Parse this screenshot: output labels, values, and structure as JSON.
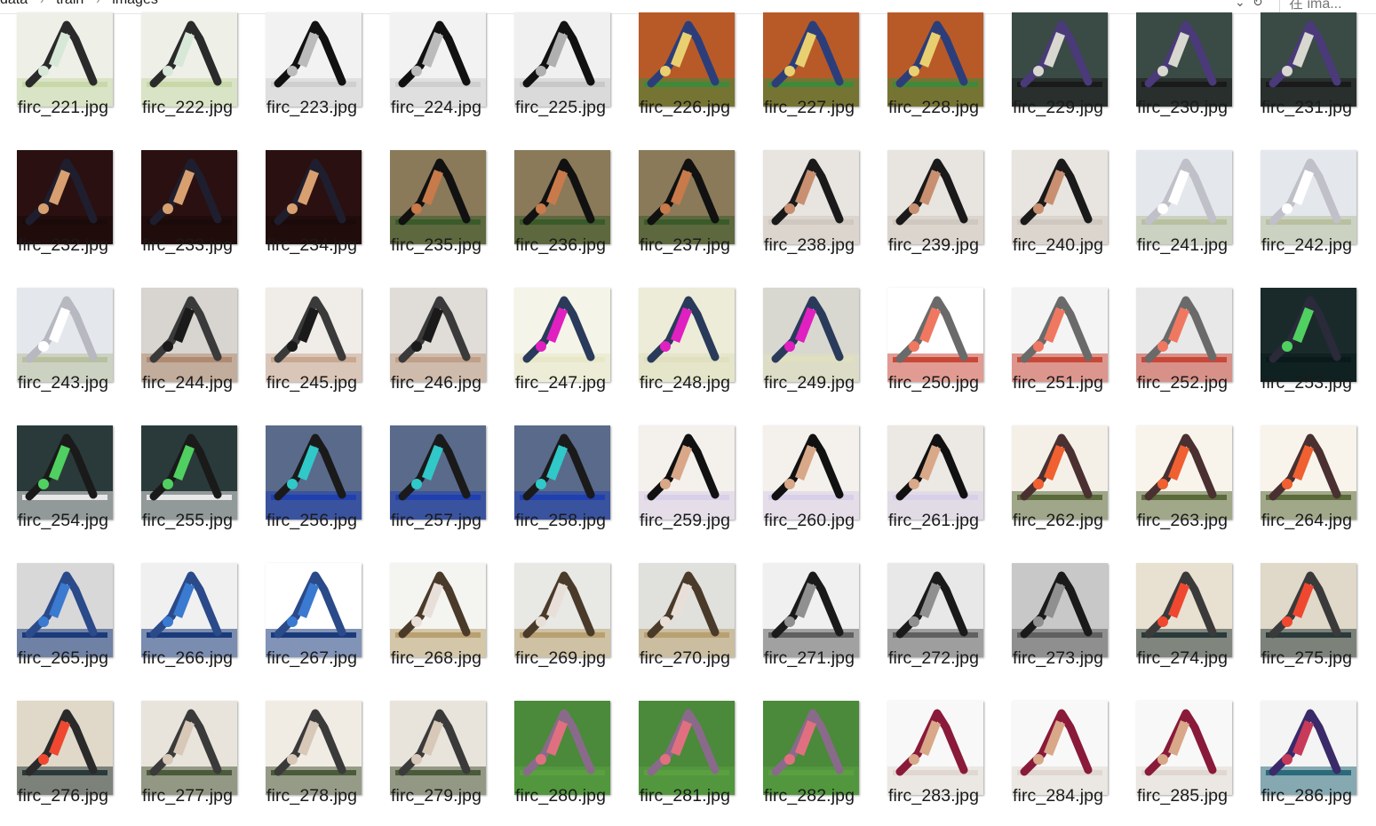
{
  "explorer": {
    "breadcrumb": [
      "data",
      "train",
      "images"
    ],
    "search_placeholder": "在 ima...",
    "accent": "#0078d7"
  },
  "files": [
    {
      "name": "firc_221.jpg",
      "palette": [
        "#eef0e8",
        "#c8d8a8",
        "#2a2a2a",
        "#d8e8d8"
      ]
    },
    {
      "name": "firc_222.jpg",
      "palette": [
        "#eef0e8",
        "#c8d8a8",
        "#2a2a2a",
        "#d8e8d8"
      ]
    },
    {
      "name": "firc_223.jpg",
      "palette": [
        "#f2f2f2",
        "#cfcfcf",
        "#111111",
        "#bbbbbb"
      ]
    },
    {
      "name": "firc_224.jpg",
      "palette": [
        "#f2f2f2",
        "#cfcfcf",
        "#111111",
        "#bbbbbb"
      ]
    },
    {
      "name": "firc_225.jpg",
      "palette": [
        "#f0f0f0",
        "#c8c8c8",
        "#111111",
        "#b0b0b0"
      ]
    },
    {
      "name": "firc_226.jpg",
      "palette": [
        "#b85a28",
        "#3f8a3a",
        "#2c3e7a",
        "#e8d070"
      ]
    },
    {
      "name": "firc_227.jpg",
      "palette": [
        "#b85a28",
        "#3f8a3a",
        "#2c3e7a",
        "#e8d070"
      ]
    },
    {
      "name": "firc_228.jpg",
      "palette": [
        "#b85a28",
        "#3f8a3a",
        "#2c3e7a",
        "#e8d070"
      ]
    },
    {
      "name": "firc_229.jpg",
      "palette": [
        "#3a4a44",
        "#1a1a1a",
        "#4a3a7a",
        "#d8d8d0"
      ]
    },
    {
      "name": "firc_230.jpg",
      "palette": [
        "#3a4a44",
        "#1a1a1a",
        "#4a3a7a",
        "#d8d8d0"
      ]
    },
    {
      "name": "firc_231.jpg",
      "palette": [
        "#3a4a44",
        "#1a1a1a",
        "#4a3a7a",
        "#d8d8d0"
      ]
    },
    {
      "name": "firc_232.jpg",
      "palette": [
        "#2a1010",
        "#1a0a0a",
        "#1e1e2e",
        "#d8a070"
      ]
    },
    {
      "name": "firc_233.jpg",
      "palette": [
        "#2a1010",
        "#1a0a0a",
        "#1e1e2e",
        "#d8a070"
      ]
    },
    {
      "name": "firc_234.jpg",
      "palette": [
        "#2a1010",
        "#1a0a0a",
        "#1e1e2e",
        "#d8a070"
      ]
    },
    {
      "name": "firc_235.jpg",
      "palette": [
        "#8a7a5a",
        "#3a5a2a",
        "#111111",
        "#c87a4a"
      ]
    },
    {
      "name": "firc_236.jpg",
      "palette": [
        "#8a7a5a",
        "#3a5a2a",
        "#111111",
        "#c87a4a"
      ]
    },
    {
      "name": "firc_237.jpg",
      "palette": [
        "#8a7a5a",
        "#3a5a2a",
        "#111111",
        "#c87a4a"
      ]
    },
    {
      "name": "firc_238.jpg",
      "palette": [
        "#e8e4e0",
        "#cfc8c0",
        "#1a1a1a",
        "#c89070"
      ]
    },
    {
      "name": "firc_239.jpg",
      "palette": [
        "#e8e4e0",
        "#cfc8c0",
        "#1a1a1a",
        "#c89070"
      ]
    },
    {
      "name": "firc_240.jpg",
      "palette": [
        "#e8e4e0",
        "#cfc8c0",
        "#1a1a1a",
        "#c89070"
      ]
    },
    {
      "name": "firc_241.jpg",
      "palette": [
        "#e4e8ec",
        "#b8c0a0",
        "#c0c0c8",
        "#ffffff"
      ]
    },
    {
      "name": "firc_242.jpg",
      "palette": [
        "#e4e8ec",
        "#b8c0a0",
        "#c0c0c8",
        "#ffffff"
      ]
    },
    {
      "name": "firc_243.jpg",
      "palette": [
        "#e4e8ec",
        "#b8c0a0",
        "#b8b8c0",
        "#ffffff"
      ]
    },
    {
      "name": "firc_244.jpg",
      "palette": [
        "#d8d4d0",
        "#b08a70",
        "#3a3a3a",
        "#1a1a1a"
      ]
    },
    {
      "name": "firc_245.jpg",
      "palette": [
        "#f0ece8",
        "#c8a890",
        "#3a3a3a",
        "#1a1a1a"
      ]
    },
    {
      "name": "firc_246.jpg",
      "palette": [
        "#e0dcd8",
        "#c0a088",
        "#3a3a3a",
        "#1a1a1a"
      ]
    },
    {
      "name": "firc_247.jpg",
      "palette": [
        "#f4f4e8",
        "#e8e8c8",
        "#2a3a5a",
        "#e020c0"
      ]
    },
    {
      "name": "firc_248.jpg",
      "palette": [
        "#ececd8",
        "#e0e0c0",
        "#2a3a5a",
        "#e020c0"
      ]
    },
    {
      "name": "firc_249.jpg",
      "palette": [
        "#d8d8d0",
        "#e0e0c0",
        "#2a3a5a",
        "#e020c0"
      ]
    },
    {
      "name": "firc_250.jpg",
      "palette": [
        "#ffffff",
        "#c84838",
        "#6a6a6a",
        "#f07860"
      ]
    },
    {
      "name": "firc_251.jpg",
      "palette": [
        "#f4f4f4",
        "#c84838",
        "#6a6a6a",
        "#f07860"
      ]
    },
    {
      "name": "firc_252.jpg",
      "palette": [
        "#e8e8e8",
        "#c84838",
        "#6a6a6a",
        "#f07860"
      ]
    },
    {
      "name": "firc_253.jpg",
      "palette": [
        "#1a2a2a",
        "#0a1a1a",
        "#2a2a3a",
        "#50d060"
      ]
    },
    {
      "name": "firc_254.jpg",
      "palette": [
        "#2a3a3a",
        "#e8e8e8",
        "#1a1a1a",
        "#50d060"
      ]
    },
    {
      "name": "firc_255.jpg",
      "palette": [
        "#2a3a3a",
        "#e8e8e8",
        "#1a1a1a",
        "#50d060"
      ]
    },
    {
      "name": "firc_256.jpg",
      "palette": [
        "#5a6a8a",
        "#2040b0",
        "#1a1a1a",
        "#30c8c8"
      ]
    },
    {
      "name": "firc_257.jpg",
      "palette": [
        "#5a6a8a",
        "#2040b0",
        "#1a1a1a",
        "#30c8c8"
      ]
    },
    {
      "name": "firc_258.jpg",
      "palette": [
        "#5a6a8a",
        "#2040b0",
        "#1a1a1a",
        "#30c8c8"
      ]
    },
    {
      "name": "firc_259.jpg",
      "palette": [
        "#f4f0ec",
        "#d8d0e8",
        "#111111",
        "#d8a888"
      ]
    },
    {
      "name": "firc_260.jpg",
      "palette": [
        "#f4f0ec",
        "#d8d0e8",
        "#111111",
        "#d8a888"
      ]
    },
    {
      "name": "firc_261.jpg",
      "palette": [
        "#ece8e4",
        "#d8d0e8",
        "#111111",
        "#d8a888"
      ]
    },
    {
      "name": "firc_262.jpg",
      "palette": [
        "#f4f0e8",
        "#5a6a3a",
        "#4a3030",
        "#f06030"
      ]
    },
    {
      "name": "firc_263.jpg",
      "palette": [
        "#f8f4ec",
        "#5a6a3a",
        "#4a3030",
        "#f06030"
      ]
    },
    {
      "name": "firc_264.jpg",
      "palette": [
        "#f8f4ec",
        "#5a6a3a",
        "#4a3030",
        "#f06030"
      ]
    },
    {
      "name": "firc_265.jpg",
      "palette": [
        "#d8d8d8",
        "#1a3a7a",
        "#2a4a8a",
        "#3a7ad0"
      ]
    },
    {
      "name": "firc_266.jpg",
      "palette": [
        "#f0f0f0",
        "#1a3a7a",
        "#2a4a8a",
        "#3a7ad0"
      ]
    },
    {
      "name": "firc_267.jpg",
      "palette": [
        "#ffffff",
        "#1a3a7a",
        "#2a4a8a",
        "#3a7ad0"
      ]
    },
    {
      "name": "firc_268.jpg",
      "palette": [
        "#f4f4f0",
        "#b8a070",
        "#4a3a2a",
        "#e8e0d8"
      ]
    },
    {
      "name": "firc_269.jpg",
      "palette": [
        "#e8e8e4",
        "#b8a070",
        "#4a3a2a",
        "#e8e0d8"
      ]
    },
    {
      "name": "firc_270.jpg",
      "palette": [
        "#e0e0dc",
        "#b8a070",
        "#4a3a2a",
        "#e8e0d8"
      ]
    },
    {
      "name": "firc_271.jpg",
      "palette": [
        "#f0f0f0",
        "#606060",
        "#1a1a1a",
        "#909090"
      ]
    },
    {
      "name": "firc_272.jpg",
      "palette": [
        "#e8e8e8",
        "#606060",
        "#1a1a1a",
        "#909090"
      ]
    },
    {
      "name": "firc_273.jpg",
      "palette": [
        "#c8c8c8",
        "#606060",
        "#1a1a1a",
        "#909090"
      ]
    },
    {
      "name": "firc_274.jpg",
      "palette": [
        "#e8e0d0",
        "#2a3a3a",
        "#3a3a3a",
        "#f04830"
      ]
    },
    {
      "name": "firc_275.jpg",
      "palette": [
        "#e0d8c8",
        "#2a3a3a",
        "#3a3a3a",
        "#f04830"
      ]
    },
    {
      "name": "firc_276.jpg",
      "palette": [
        "#e0d8c8",
        "#2a3a3a",
        "#2a2a2a",
        "#f04830"
      ]
    },
    {
      "name": "firc_277.jpg",
      "palette": [
        "#e8e4dc",
        "#4a5a3a",
        "#3a3a3a",
        "#d8c8b8"
      ]
    },
    {
      "name": "firc_278.jpg",
      "palette": [
        "#f0ece4",
        "#4a5a3a",
        "#3a3a3a",
        "#d8c8b8"
      ]
    },
    {
      "name": "firc_279.jpg",
      "palette": [
        "#e8e4dc",
        "#4a5a3a",
        "#3a3a3a",
        "#d8c8b8"
      ]
    },
    {
      "name": "firc_280.jpg",
      "palette": [
        "#4a8a3a",
        "#5aa040",
        "#8a6a8a",
        "#e07080"
      ]
    },
    {
      "name": "firc_281.jpg",
      "palette": [
        "#4a8a3a",
        "#5aa040",
        "#8a6a8a",
        "#e07080"
      ]
    },
    {
      "name": "firc_282.jpg",
      "palette": [
        "#4a8a3a",
        "#5aa040",
        "#8a6a8a",
        "#e07080"
      ]
    },
    {
      "name": "firc_283.jpg",
      "palette": [
        "#f8f8f8",
        "#e0d8d0",
        "#8a1a3a",
        "#d8a888"
      ]
    },
    {
      "name": "firc_284.jpg",
      "palette": [
        "#f8f8f8",
        "#e0d8d0",
        "#8a1a3a",
        "#d8a888"
      ]
    },
    {
      "name": "firc_285.jpg",
      "palette": [
        "#f8f8f8",
        "#e0d8d0",
        "#8a1a3a",
        "#d8a888"
      ]
    },
    {
      "name": "firc_286.jpg",
      "palette": [
        "#f4f4f4",
        "#2a6a7a",
        "#3a2a6a",
        "#c83a5a"
      ]
    }
  ]
}
